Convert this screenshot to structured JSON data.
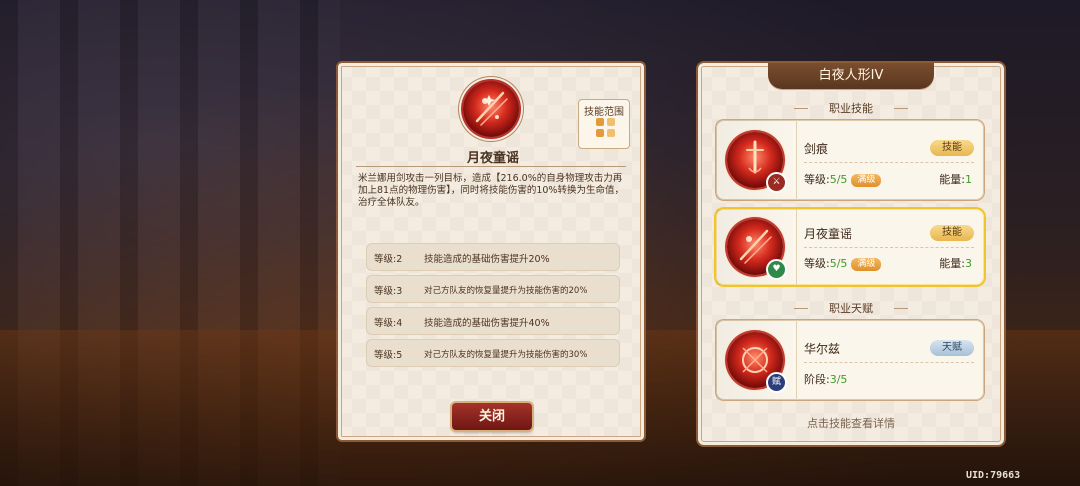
{
  "detail": {
    "skill_name": "月夜童谣",
    "range_label": "技能范围",
    "description": "米兰娜用剑攻击一列目标，造成【216.0%的自身物理攻击力再加上81点的物理伤害】，同时将技能伤害的10%转换为生命值，治疗全体队友。",
    "levels": [
      {
        "level": "等级:2",
        "text": "技能造成的基础伤害提升20%"
      },
      {
        "level": "等级:3",
        "text": "对己方队友的恢复量提升为技能伤害的20%"
      },
      {
        "level": "等级:4",
        "text": "技能造成的基础伤害提升40%"
      },
      {
        "level": "等级:5",
        "text": "对己方队友的恢复量提升为技能伤害的30%"
      }
    ],
    "close_label": "关闭"
  },
  "job": {
    "title": "白夜人形IV",
    "skills_header": "职业技能",
    "talent_header": "职业天赋",
    "skills": [
      {
        "name": "剑痕",
        "tag": "技能",
        "level_prefix": "等级:",
        "level_value": "5/5",
        "max_tag": "满级",
        "energy_prefix": "能量:",
        "energy_value": "1",
        "badge_icon": "sword-icon"
      },
      {
        "name": "月夜童谣",
        "tag": "技能",
        "level_prefix": "等级:",
        "level_value": "5/5",
        "max_tag": "满级",
        "energy_prefix": "能量:",
        "energy_value": "3",
        "badge_icon": "heart-icon",
        "selected": true
      }
    ],
    "talent": {
      "name": "华尔兹",
      "tag": "天赋",
      "stage_prefix": "阶段:",
      "stage_value": "3/5",
      "badge": "赋"
    },
    "hint": "点击技能查看详情"
  },
  "uid": "UID:79663",
  "colors": {
    "accent_red": "#a6332a",
    "gold": "#f0c52c",
    "green": "#3f9a2a",
    "frame": "#8a5b36"
  }
}
